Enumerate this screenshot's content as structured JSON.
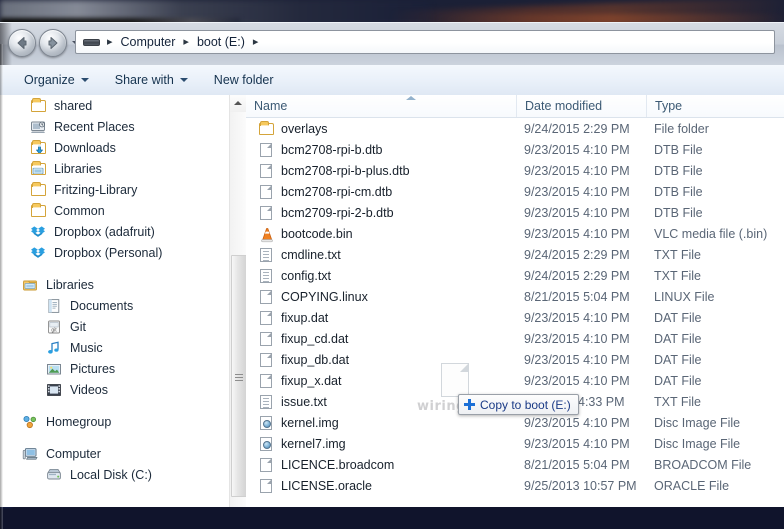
{
  "window": {
    "address_bar": {
      "computer_icon": "computer-drive-icon",
      "crumbs": [
        "Computer",
        "boot (E:)"
      ],
      "separator": "▸"
    },
    "nav": {
      "back_label": "Back",
      "forward_label": "Forward",
      "history_label": "Recent pages"
    }
  },
  "toolbar": {
    "items": [
      {
        "label": "Organize",
        "caret": true
      },
      {
        "label": "Share with",
        "caret": true
      },
      {
        "label": "New folder",
        "caret": false
      }
    ]
  },
  "sidebar": {
    "groups": [
      {
        "items": [
          {
            "label": "shared",
            "icon": "folder-icon",
            "indent": 1
          },
          {
            "label": "Recent Places",
            "icon": "recent-places-icon",
            "indent": 1
          },
          {
            "label": "Downloads",
            "icon": "downloads-icon",
            "indent": 1
          },
          {
            "label": "Libraries",
            "icon": "libraries-folder-icon",
            "indent": 1
          },
          {
            "label": "Fritzing-Library",
            "icon": "folder-icon",
            "indent": 1
          },
          {
            "label": "Common",
            "icon": "folder-icon",
            "indent": 1
          },
          {
            "label": "Dropbox (adafruit)",
            "icon": "dropbox-icon",
            "indent": 1
          },
          {
            "label": "Dropbox (Personal)",
            "icon": "dropbox-icon",
            "indent": 1
          }
        ]
      },
      {
        "items": [
          {
            "label": "Libraries",
            "icon": "libraries-icon",
            "indent": 0
          },
          {
            "label": "Documents",
            "icon": "documents-icon",
            "indent": 2
          },
          {
            "label": "Git",
            "icon": "git-icon",
            "indent": 2
          },
          {
            "label": "Music",
            "icon": "music-icon",
            "indent": 2
          },
          {
            "label": "Pictures",
            "icon": "pictures-icon",
            "indent": 2
          },
          {
            "label": "Videos",
            "icon": "videos-icon",
            "indent": 2
          }
        ]
      },
      {
        "items": [
          {
            "label": "Homegroup",
            "icon": "homegroup-icon",
            "indent": 0
          }
        ]
      },
      {
        "items": [
          {
            "label": "Computer",
            "icon": "computer-icon",
            "indent": 0
          },
          {
            "label": "Local Disk (C:)",
            "icon": "local-disk-icon",
            "indent": 2
          }
        ]
      }
    ]
  },
  "file_list": {
    "columns": [
      "Name",
      "Date modified",
      "Type"
    ],
    "sorted_column": "Name",
    "sort_direction": "ascending",
    "rows": [
      {
        "name": "overlays",
        "date": "9/24/2015 2:29 PM",
        "type": "File folder",
        "icon": "folder-icon"
      },
      {
        "name": "bcm2708-rpi-b.dtb",
        "date": "9/23/2015 4:10 PM",
        "type": "DTB File",
        "icon": "generic-file-icon"
      },
      {
        "name": "bcm2708-rpi-b-plus.dtb",
        "date": "9/23/2015 4:10 PM",
        "type": "DTB File",
        "icon": "generic-file-icon"
      },
      {
        "name": "bcm2708-rpi-cm.dtb",
        "date": "9/23/2015 4:10 PM",
        "type": "DTB File",
        "icon": "generic-file-icon"
      },
      {
        "name": "bcm2709-rpi-2-b.dtb",
        "date": "9/23/2015 4:10 PM",
        "type": "DTB File",
        "icon": "generic-file-icon"
      },
      {
        "name": "bootcode.bin",
        "date": "9/23/2015 4:10 PM",
        "type": "VLC media file (.bin)",
        "icon": "vlc-cone-icon"
      },
      {
        "name": "cmdline.txt",
        "date": "9/24/2015 2:29 PM",
        "type": "TXT File",
        "icon": "text-file-icon"
      },
      {
        "name": "config.txt",
        "date": "9/24/2015 2:29 PM",
        "type": "TXT File",
        "icon": "text-file-icon"
      },
      {
        "name": "COPYING.linux",
        "date": "8/21/2015 5:04 PM",
        "type": "LINUX File",
        "icon": "generic-file-icon"
      },
      {
        "name": "fixup.dat",
        "date": "9/23/2015 4:10 PM",
        "type": "DAT File",
        "icon": "generic-file-icon"
      },
      {
        "name": "fixup_cd.dat",
        "date": "9/23/2015 4:10 PM",
        "type": "DAT File",
        "icon": "generic-file-icon"
      },
      {
        "name": "fixup_db.dat",
        "date": "9/23/2015 4:10 PM",
        "type": "DAT File",
        "icon": "generic-file-icon"
      },
      {
        "name": "fixup_x.dat",
        "date": "9/23/2015 4:10 PM",
        "type": "DAT File",
        "icon": "generic-file-icon"
      },
      {
        "name": "issue.txt",
        "date": "4:33 PM",
        "type": "TXT File",
        "icon": "text-file-icon"
      },
      {
        "name": "kernel.img",
        "date": "9/23/2015 4:10 PM",
        "type": "Disc Image File",
        "icon": "disc-image-icon"
      },
      {
        "name": "kernel7.img",
        "date": "9/23/2015 4:10 PM",
        "type": "Disc Image File",
        "icon": "disc-image-icon"
      },
      {
        "name": "LICENCE.broadcom",
        "date": "8/21/2015 5:04 PM",
        "type": "BROADCOM File",
        "icon": "generic-file-icon"
      },
      {
        "name": "LICENSE.oracle",
        "date": "9/25/2013 10:57 PM",
        "type": "ORACLE File",
        "icon": "generic-file-icon"
      }
    ]
  },
  "drag_drop": {
    "tooltip_label": "Copy to boot (E:)",
    "tooltip_icon": "plus-icon",
    "tooltip_accent": "#1b6fd6",
    "tooltip_text_color": "#1a3a86",
    "watermark": "wiringPi"
  }
}
